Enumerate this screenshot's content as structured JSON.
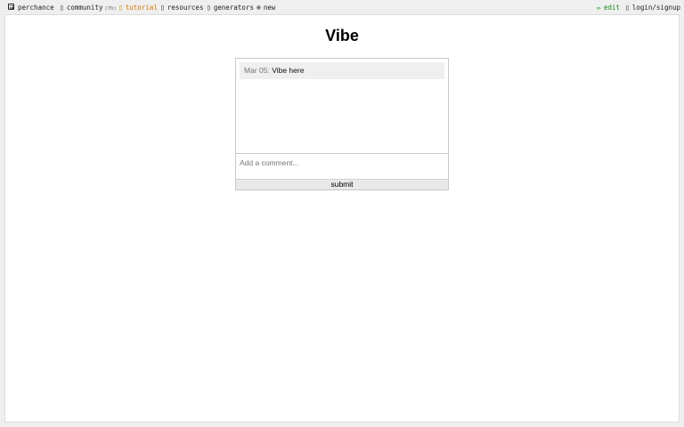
{
  "nav": {
    "perchance": "perchance",
    "community": "community",
    "community_count": "(7h)",
    "tutorial": "tutorial",
    "resources": "resources",
    "generators": "generators",
    "new": "new",
    "edit": "edit",
    "login": "login/signup"
  },
  "icons": {
    "community": "chat-icon",
    "tutorial": "book-icon",
    "resources": "link-icon",
    "generators": "list-icon",
    "new": "plus-circle-icon",
    "edit": "pencil-icon",
    "login": "user-icon"
  },
  "colors": {
    "tutorial": "#d47800",
    "edit": "#1e8a1e"
  },
  "page": {
    "title": "Vibe"
  },
  "comments": {
    "items": [
      {
        "date": "Mar 05:",
        "text": "Vibe here"
      }
    ],
    "input_placeholder": "Add a comment...",
    "submit_label": "submit"
  }
}
